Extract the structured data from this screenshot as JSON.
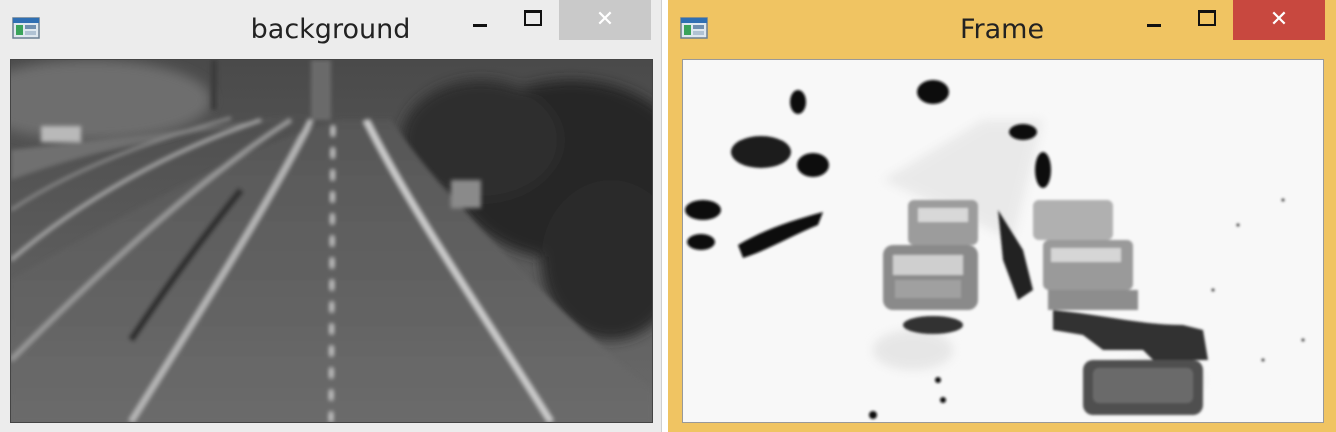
{
  "windows": [
    {
      "title": "background",
      "icon": "app-window-icon",
      "close_glyph": "✕",
      "active": false,
      "accent": "#ececec"
    },
    {
      "title": "Frame",
      "icon": "app-window-icon",
      "close_glyph": "✕",
      "active": true,
      "accent": "#f0c462",
      "close_color": "#c8483f"
    }
  ]
}
